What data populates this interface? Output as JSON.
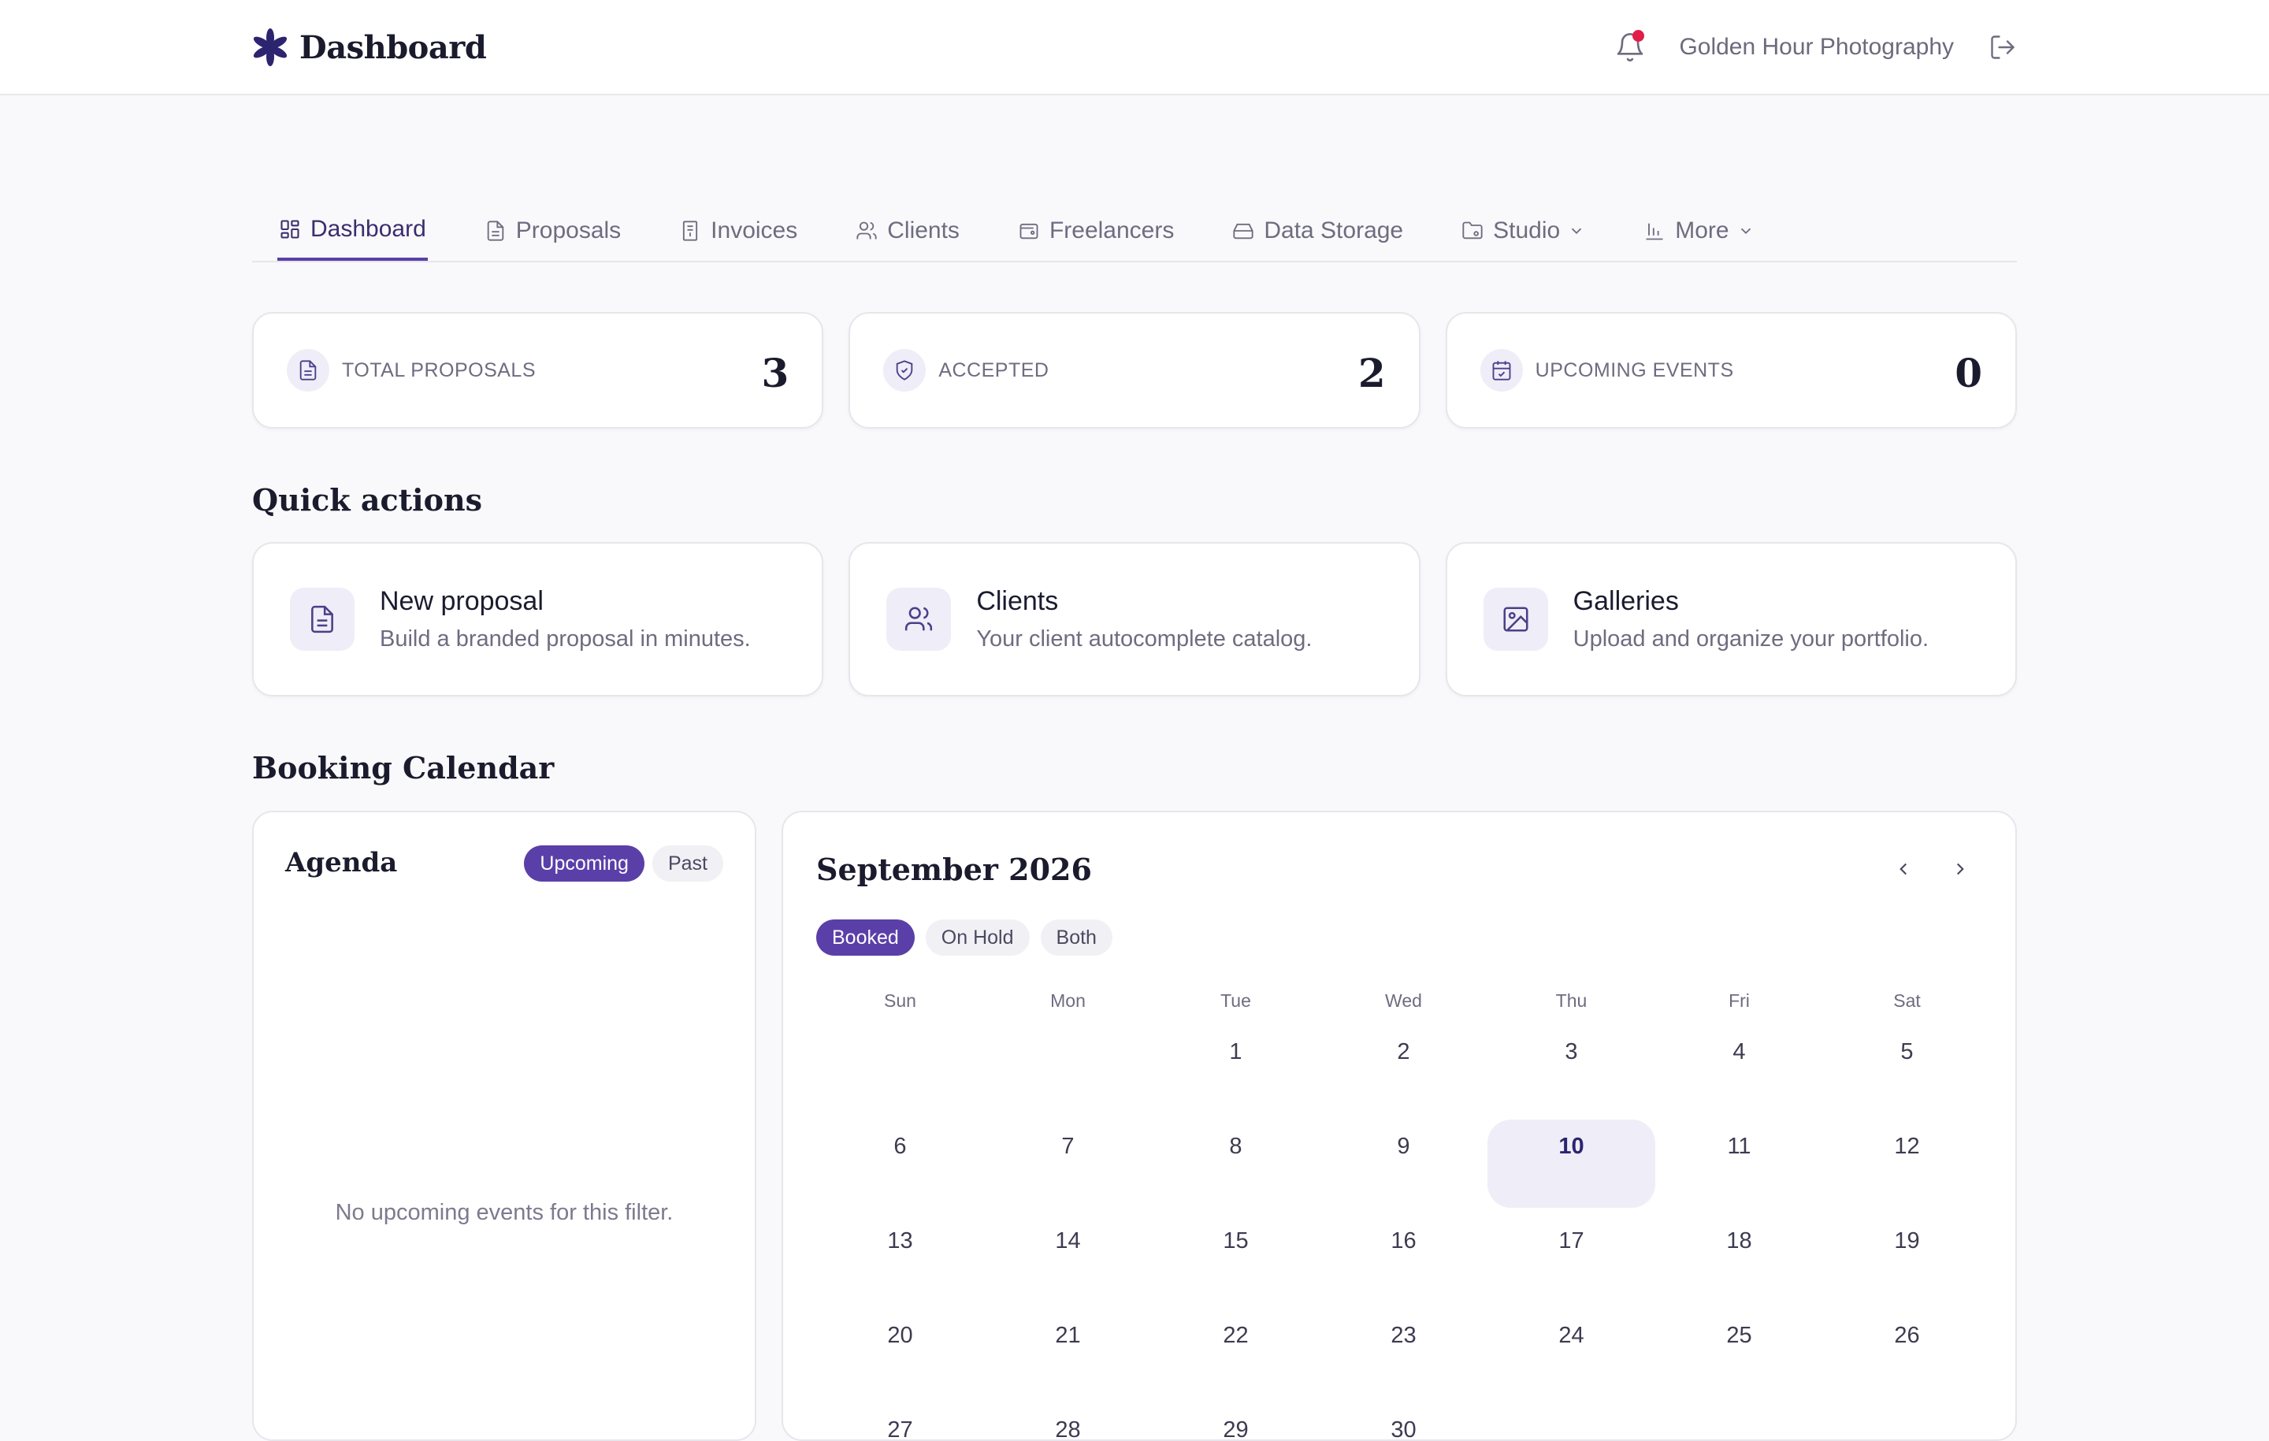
{
  "header": {
    "app_title": "Dashboard",
    "user_name": "Golden Hour Photography"
  },
  "nav": {
    "tabs": [
      {
        "label": "Dashboard",
        "icon": "dashboard-grid-icon",
        "active": true
      },
      {
        "label": "Proposals",
        "icon": "document-icon"
      },
      {
        "label": "Invoices",
        "icon": "receipt-icon"
      },
      {
        "label": "Clients",
        "icon": "users-icon"
      },
      {
        "label": "Freelancers",
        "icon": "wallet-icon"
      },
      {
        "label": "Data Storage",
        "icon": "hard-drive-icon"
      },
      {
        "label": "Studio",
        "icon": "folder-settings-icon",
        "dropdown": true
      },
      {
        "label": "More",
        "icon": "bar-chart-icon",
        "dropdown": true
      }
    ]
  },
  "stats": [
    {
      "label": "TOTAL PROPOSALS",
      "value": "3",
      "icon": "document-icon"
    },
    {
      "label": "ACCEPTED",
      "value": "2",
      "icon": "shield-check-icon"
    },
    {
      "label": "UPCOMING EVENTS",
      "value": "0",
      "icon": "calendar-check-icon"
    }
  ],
  "quick_actions": {
    "title": "Quick actions",
    "items": [
      {
        "title": "New proposal",
        "description": "Build a branded proposal in minutes.",
        "icon": "document-icon"
      },
      {
        "title": "Clients",
        "description": "Your client autocomplete catalog.",
        "icon": "users-icon"
      },
      {
        "title": "Galleries",
        "description": "Upload and organize your portfolio.",
        "icon": "image-icon"
      }
    ]
  },
  "booking": {
    "title": "Booking Calendar",
    "agenda": {
      "title": "Agenda",
      "filters": [
        {
          "label": "Upcoming",
          "active": true
        },
        {
          "label": "Past"
        }
      ],
      "empty_message": "No upcoming events for this filter."
    },
    "calendar": {
      "month_label": "September 2026",
      "filters": [
        {
          "label": "Booked",
          "active": true
        },
        {
          "label": "On Hold"
        },
        {
          "label": "Both"
        }
      ],
      "weekdays": [
        "Sun",
        "Mon",
        "Tue",
        "Wed",
        "Thu",
        "Fri",
        "Sat"
      ],
      "weeks": [
        [
          "",
          "",
          "1",
          "2",
          "3",
          "4",
          "5"
        ],
        [
          "6",
          "7",
          "8",
          "9",
          "10",
          "11",
          "12"
        ],
        [
          "13",
          "14",
          "15",
          "16",
          "17",
          "18",
          "19"
        ],
        [
          "20",
          "21",
          "22",
          "23",
          "24",
          "25",
          "26"
        ],
        [
          "27",
          "28",
          "29",
          "30",
          "",
          "",
          ""
        ]
      ],
      "today": "10"
    }
  },
  "colors": {
    "accent": "#5b3fa8",
    "accent_soft": "#efedf7",
    "notification_dot": "#e11d48",
    "background": "#f9f9fb"
  }
}
